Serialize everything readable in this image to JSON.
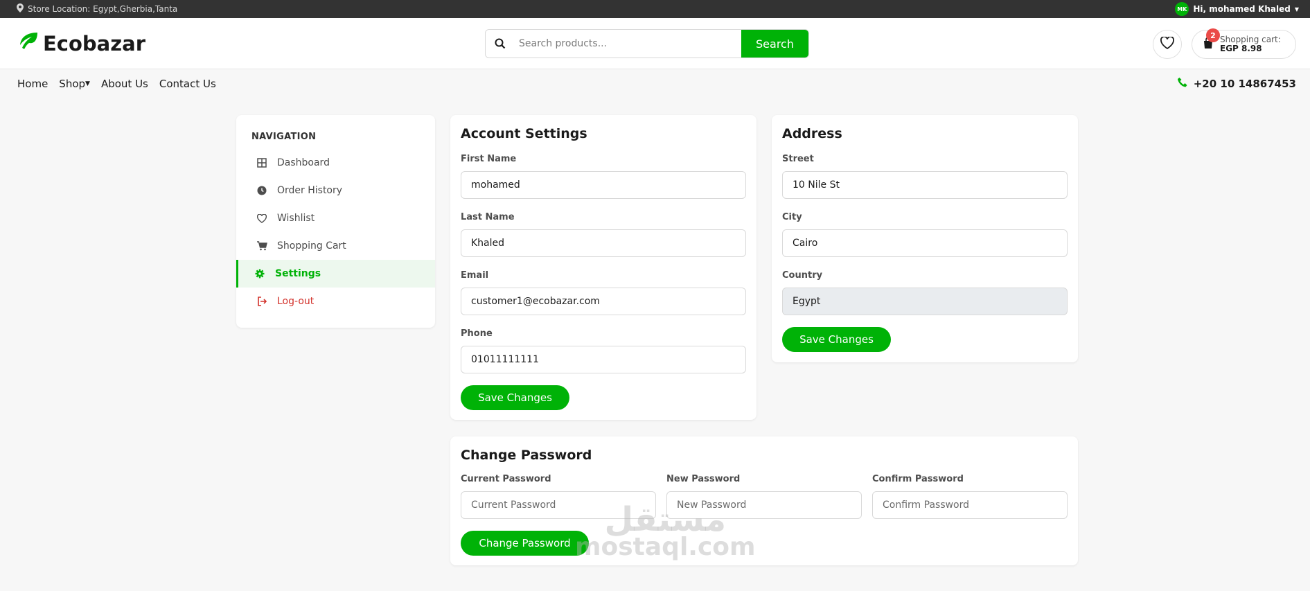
{
  "topbar": {
    "store_location": "Store Location: Egypt,Gherbia,Tanta",
    "avatar_initials": "MK",
    "greeting": "Hi, mohamed Khaled"
  },
  "header": {
    "brand": "Ecobazar",
    "search_placeholder": "Search products...",
    "search_button": "Search",
    "cart_count": "2",
    "cart_label": "Shopping cart:",
    "cart_amount": "EGP 8.98"
  },
  "nav": {
    "links": [
      "Home",
      "Shop",
      "About Us",
      "Contact Us"
    ],
    "phone": "+20 10 14867453"
  },
  "sidebar": {
    "title": "NAVIGATION",
    "items": [
      {
        "label": "Dashboard",
        "icon": "grid-icon"
      },
      {
        "label": "Order History",
        "icon": "clock-icon"
      },
      {
        "label": "Wishlist",
        "icon": "heart-icon"
      },
      {
        "label": "Shopping Cart",
        "icon": "cart-icon"
      },
      {
        "label": "Settings",
        "icon": "gear-icon",
        "active": true
      },
      {
        "label": "Log-out",
        "icon": "logout-icon"
      }
    ]
  },
  "account": {
    "title": "Account Settings",
    "first_name_label": "First Name",
    "first_name": "mohamed",
    "last_name_label": "Last Name",
    "last_name": "Khaled",
    "email_label": "Email",
    "email": "customer1@ecobazar.com",
    "phone_label": "Phone",
    "phone": "01011111111",
    "save_button": "Save Changes"
  },
  "address": {
    "title": "Address",
    "street_label": "Street",
    "street": "10 Nile St",
    "city_label": "City",
    "city": "Cairo",
    "country_label": "Country",
    "country": "Egypt",
    "save_button": "Save Changes"
  },
  "password": {
    "title": "Change Password",
    "current_label": "Current Password",
    "current_placeholder": "Current Password",
    "new_label": "New Password",
    "new_placeholder": "New Password",
    "confirm_label": "Confirm Password",
    "confirm_placeholder": "Confirm Password",
    "button": "Change Password"
  },
  "watermark": {
    "arabic": "مستقل",
    "latin": "mostaql.com"
  },
  "colors": {
    "primary": "#00b207",
    "topbar": "#333333",
    "danger": "#d2312a",
    "badge": "#ea4b48"
  }
}
